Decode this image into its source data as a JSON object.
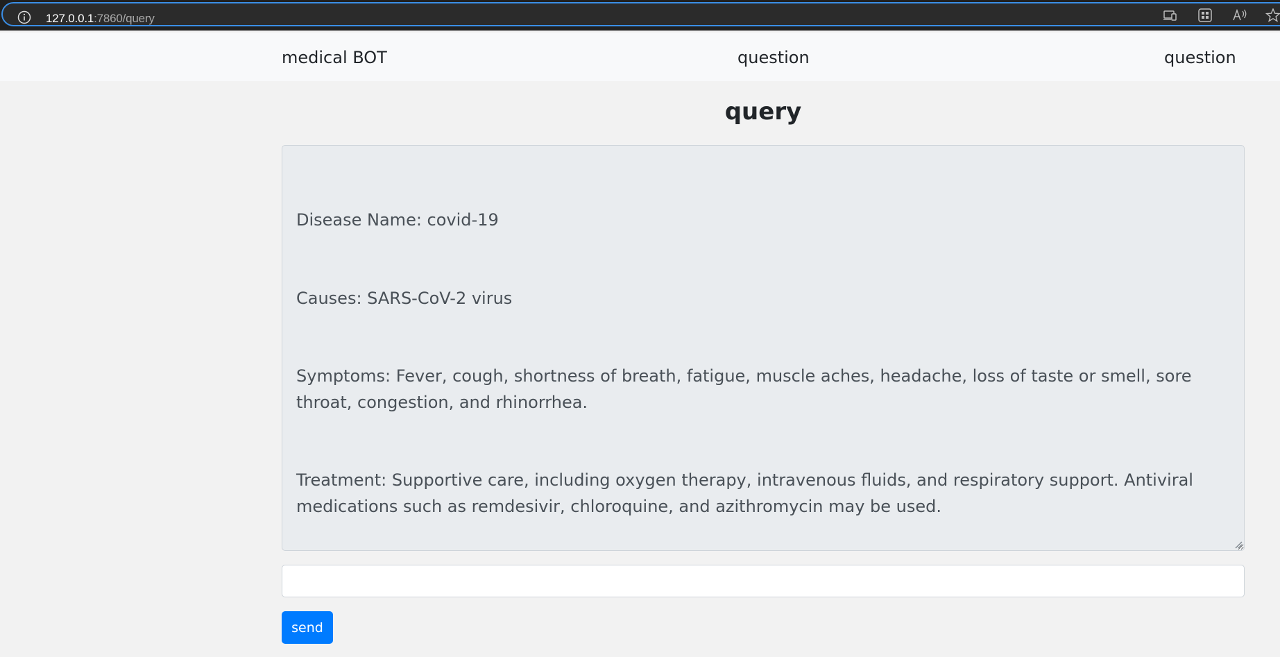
{
  "browser": {
    "url_host": "127.0.0.1",
    "url_path": ":7860/query",
    "icons": [
      "info-icon",
      "device-icon",
      "apps-icon",
      "read-aloud-icon",
      "favorite-star-icon"
    ]
  },
  "navbar": {
    "brand": "medical BOT",
    "link_1": "question",
    "link_2": "question"
  },
  "main": {
    "title": "query",
    "output_lines": [
      "Disease Name: covid-19",
      "Causes: SARS-CoV-2 virus",
      "Symptoms: Fever, cough, shortness of breath, fatigue, muscle aches, headache, loss of taste or smell, sore throat, congestion, and rhinorrhea.",
      "Treatment: Supportive care, including oxygen therapy, intravenous fluids, and respiratory support. Antiviral medications such as remdesivir, chloroquine, and azithromycin may be used."
    ],
    "input_value": "",
    "send_label": "send"
  },
  "colors": {
    "background": "#f2f2f2",
    "navbar": "#f8f9fa",
    "output_background": "#e9ecef",
    "primary_button": "#007bff"
  }
}
